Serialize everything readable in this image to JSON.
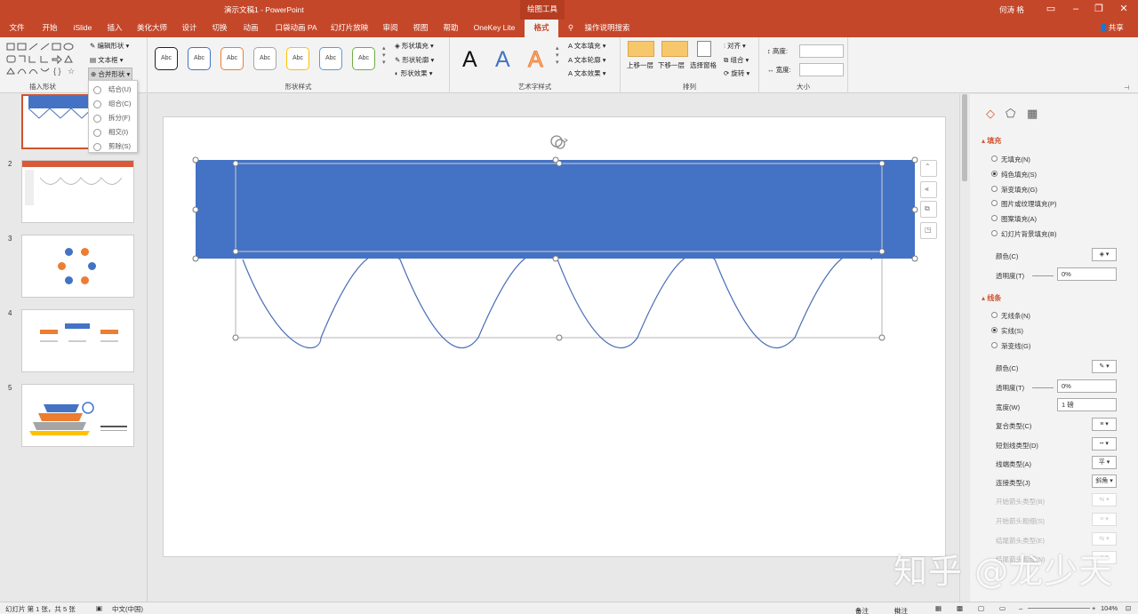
{
  "window": {
    "title": "演示文稿1 - PowerPoint",
    "context_tab": "绘图工具",
    "user": "何涛 格",
    "minimize_icon": "minimize-icon",
    "restore_icon": "restore-icon",
    "close_icon": "close-icon",
    "share": "共享"
  },
  "tabs": [
    {
      "label": "文件"
    },
    {
      "label": "开始"
    },
    {
      "label": "iSlide"
    },
    {
      "label": "插入"
    },
    {
      "label": "美化大师"
    },
    {
      "label": "设计"
    },
    {
      "label": "切换"
    },
    {
      "label": "动画"
    },
    {
      "label": "口袋动画 PA"
    },
    {
      "label": "幻灯片放映"
    },
    {
      "label": "审阅"
    },
    {
      "label": "视图"
    },
    {
      "label": "帮助"
    },
    {
      "label": "OneKey Lite"
    },
    {
      "label": "格式"
    }
  ],
  "tell_me": "操作说明搜索",
  "ribbon": {
    "insert_shapes": {
      "label": "插入形状",
      "edit_shape": "编辑形状",
      "textbox": "文本框",
      "merge_shapes": "合并形状"
    },
    "shape_styles": {
      "label": "形状样式",
      "style_sample": "Abc",
      "fill": "形状填充",
      "outline": "形状轮廓",
      "effects": "形状效果"
    },
    "wordart": {
      "label": "艺术字样式",
      "sample": "A",
      "text_fill": "文本填充",
      "text_outline": "文本轮廓",
      "text_effects": "文本效果"
    },
    "arrange": {
      "label": "排列",
      "bring_forward": "上移一层",
      "send_backward": "下移一层",
      "selection_pane": "选择窗格",
      "align": "对齐",
      "group": "组合",
      "rotate": "旋转"
    },
    "size": {
      "label": "大小",
      "height_label": "高度:",
      "width_label": "宽度:",
      "height_value": "",
      "width_value": ""
    }
  },
  "merge_menu": [
    {
      "label": "结合(U)"
    },
    {
      "label": "组合(C)"
    },
    {
      "label": "拆分(F)"
    },
    {
      "label": "相交(I)"
    },
    {
      "label": "剪除(S)"
    }
  ],
  "thumbnails": [
    {
      "number": ""
    },
    {
      "number": "2"
    },
    {
      "number": "3"
    },
    {
      "number": "4"
    },
    {
      "number": "5"
    }
  ],
  "format_pane": {
    "fill_section": "填充",
    "fill_options": [
      {
        "label": "无填充(N)",
        "selected": false
      },
      {
        "label": "纯色填充(S)",
        "selected": true
      },
      {
        "label": "渐变填充(G)",
        "selected": false
      },
      {
        "label": "图片或纹理填充(P)",
        "selected": false
      },
      {
        "label": "图案填充(A)",
        "selected": false
      },
      {
        "label": "幻灯片背景填充(B)",
        "selected": false
      }
    ],
    "fill_color_label": "颜色(C)",
    "fill_transparency_label": "透明度(T)",
    "fill_transparency_value": "0%",
    "line_section": "线条",
    "line_options": [
      {
        "label": "无线条(N)",
        "selected": false
      },
      {
        "label": "实线(S)",
        "selected": true
      },
      {
        "label": "渐变线(G)",
        "selected": false
      }
    ],
    "line_color_label": "颜色(C)",
    "line_transparency_label": "透明度(T)",
    "line_transparency_value": "0%",
    "width_label": "宽度(W)",
    "width_value": "1 磅",
    "compound_label": "复合类型(C)",
    "dash_label": "短划线类型(D)",
    "cap_label": "线端类型(A)",
    "cap_value": "平",
    "join_label": "连接类型(J)",
    "join_value": "斜角",
    "begin_arrow_type": "开始箭头类型(B)",
    "begin_arrow_size": "开始箭头粗细(S)",
    "end_arrow_type": "结尾箭头类型(E)",
    "end_arrow_size": "结尾箭头粗细(N)"
  },
  "slide": {
    "rect_color": "#4472c4",
    "wave_color": "#4a6fb5"
  },
  "status": {
    "slide_info": "幻灯片 第 1 张，共 5 张",
    "language": "中文(中国)",
    "notes": "备注",
    "comments": "批注",
    "zoom": "104%"
  },
  "watermark": "知乎 @龙少天"
}
